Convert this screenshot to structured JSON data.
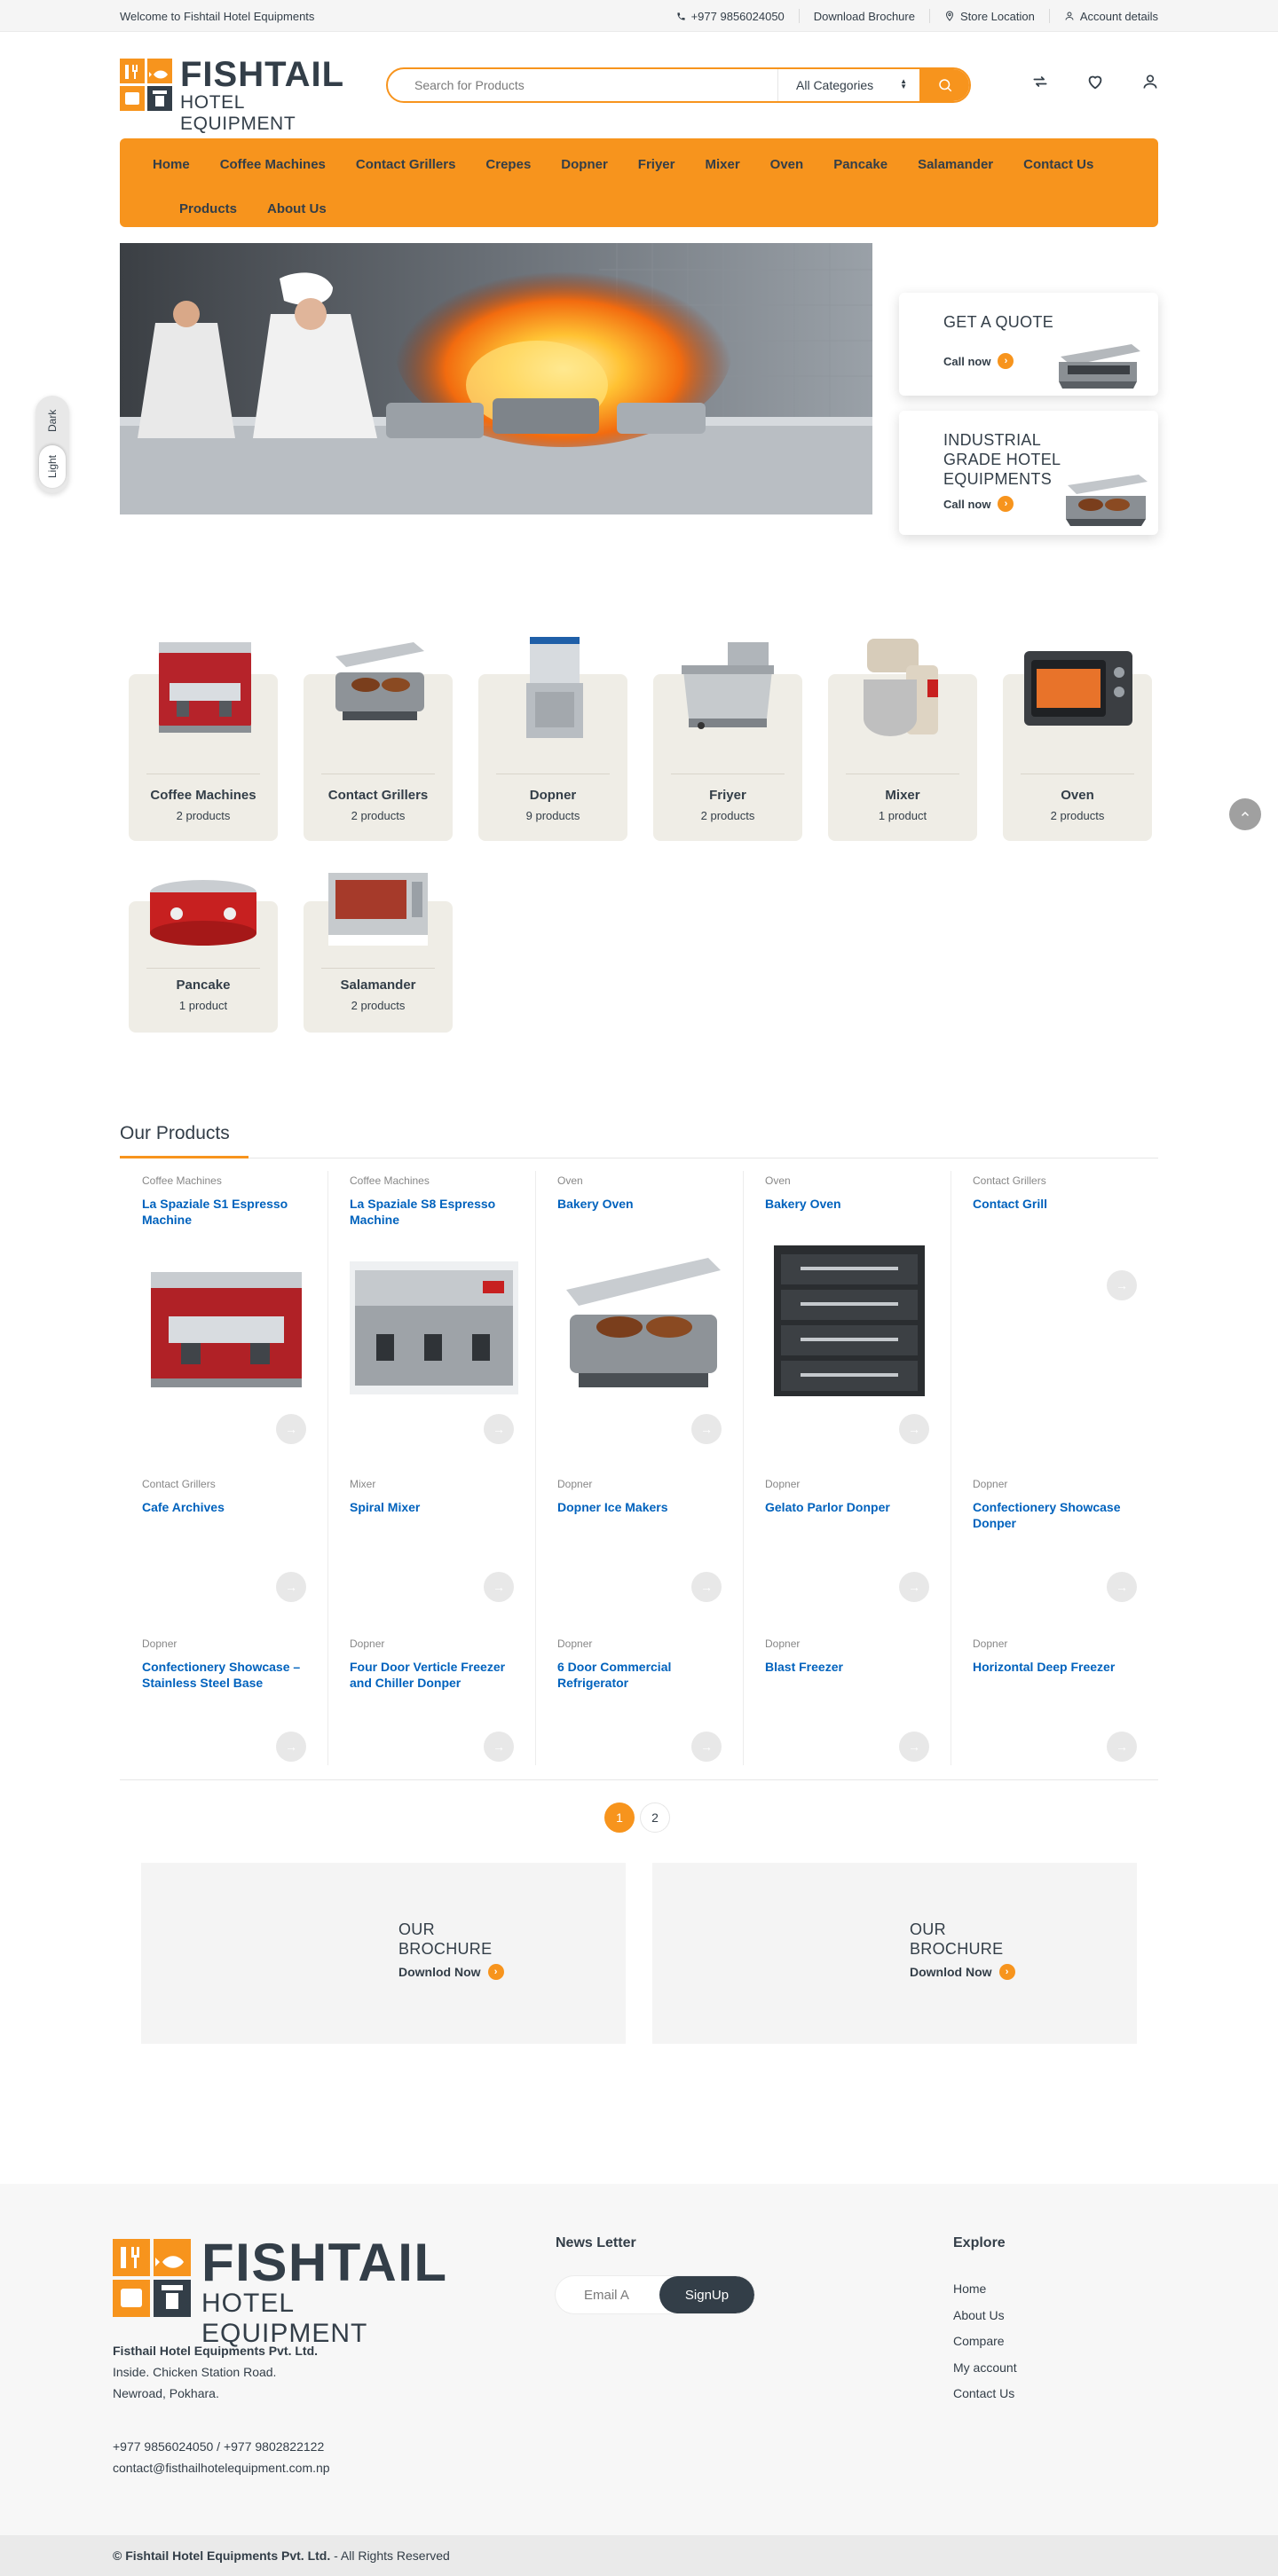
{
  "topbar": {
    "welcome": "Welcome to Fishtail Hotel Equipments",
    "phone": "+977 9856024050",
    "brochure": "Download Brochure",
    "store": "Store Location",
    "account": "Account details"
  },
  "logo": {
    "line1": "FISHTAIL",
    "line2": "HOTEL EQUIPMENT"
  },
  "search": {
    "placeholder": "Search for Products",
    "category": "All Categories"
  },
  "nav": {
    "row1": [
      "Home",
      "Coffee Machines",
      "Contact Grillers",
      "Crepes",
      "Dopner",
      "Friyer",
      "Mixer",
      "Oven",
      "Pancake",
      "Salamander",
      "Contact Us"
    ],
    "row2": [
      "Products",
      "About Us"
    ]
  },
  "promos": [
    {
      "title": "GET A QUOTE",
      "cta": "Call now"
    },
    {
      "title": "INDUSTRIAL GRADE HOTEL EQUIPMENTS",
      "cta": "Call now"
    }
  ],
  "theme": {
    "dark": "Dark",
    "light": "Light"
  },
  "categories": [
    {
      "name": "Coffee Machines",
      "count": "2 products"
    },
    {
      "name": "Contact Grillers",
      "count": "2 products"
    },
    {
      "name": "Dopner",
      "count": "9 products"
    },
    {
      "name": "Friyer",
      "count": "2 products"
    },
    {
      "name": "Mixer",
      "count": "1 product"
    },
    {
      "name": "Oven",
      "count": "2 products"
    },
    {
      "name": "Pancake",
      "count": "1 product"
    },
    {
      "name": "Salamander",
      "count": "2 products"
    }
  ],
  "products_section": {
    "title": "Our Products"
  },
  "products": [
    {
      "category": "Coffee Machines",
      "name": "La Spaziale S1 Espresso Machine"
    },
    {
      "category": "Coffee Machines",
      "name": "La Spaziale S8 Espresso Machine"
    },
    {
      "category": "Oven",
      "name": "Bakery Oven"
    },
    {
      "category": "Oven",
      "name": "Bakery Oven"
    },
    {
      "category": "Contact Grillers",
      "name": "Contact Grill"
    },
    {
      "category": "Contact Grillers",
      "name": "Cafe Archives"
    },
    {
      "category": "Mixer",
      "name": "Spiral Mixer"
    },
    {
      "category": "Dopner",
      "name": "Dopner Ice Makers"
    },
    {
      "category": "Dopner",
      "name": "Gelato Parlor Donper"
    },
    {
      "category": "Dopner",
      "name": "Confectionery Showcase Donper"
    },
    {
      "category": "Dopner",
      "name": "Confectionery Showcase – Stainless Steel Base"
    },
    {
      "category": "Dopner",
      "name": "Four Door Verticle Freezer and Chiller Donper"
    },
    {
      "category": "Dopner",
      "name": "6 Door Commercial Refrigerator"
    },
    {
      "category": "Dopner",
      "name": "Blast Freezer"
    },
    {
      "category": "Dopner",
      "name": "Horizontal Deep Freezer"
    }
  ],
  "pagination": {
    "current": "1",
    "next": "2"
  },
  "brochures": [
    {
      "line1": "OUR",
      "line2": "BROCHURE",
      "cta": "Downlod Now"
    },
    {
      "line1": "OUR",
      "line2": "BROCHURE",
      "cta": "Downlod Now"
    }
  ],
  "footer": {
    "company": "Fisthail Hotel Equipments Pvt. Ltd.",
    "address1": "Inside. Chicken Station Road.",
    "address2": "Newroad, Pokhara.",
    "phones": "+977 9856024050 / +977 9802822122",
    "email": "contact@fisthailhotelequipment.com.np",
    "newsletter_title": "News Letter",
    "email_placeholder": "Email A",
    "signup": "SignUp",
    "explore_title": "Explore",
    "explore": [
      "Home",
      "About Us",
      "Compare",
      "My account",
      "Contact Us"
    ],
    "copyright_bold": "© Fishtail Hotel Equipments Pvt. Ltd.",
    "copyright_rest": " - All Rights Reserved"
  },
  "colors": {
    "accent": "#f7941d",
    "link": "#0062bd",
    "text": "#333e48",
    "dark": "#333e48"
  }
}
